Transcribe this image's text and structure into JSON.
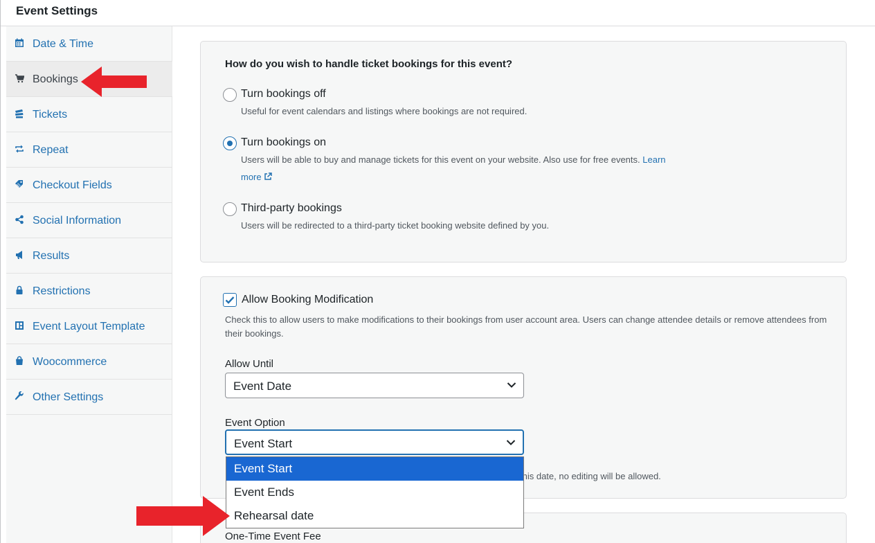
{
  "header": {
    "title": "Event Settings"
  },
  "sidebar": {
    "items": [
      {
        "label": "Date & Time",
        "icon": "calendar-icon"
      },
      {
        "label": "Bookings",
        "icon": "cart-icon"
      },
      {
        "label": "Tickets",
        "icon": "tickets-icon"
      },
      {
        "label": "Repeat",
        "icon": "repeat-icon"
      },
      {
        "label": "Checkout Fields",
        "icon": "tag-icon"
      },
      {
        "label": "Social Information",
        "icon": "share-icon"
      },
      {
        "label": "Results",
        "icon": "megaphone-icon"
      },
      {
        "label": "Restrictions",
        "icon": "lock-icon"
      },
      {
        "label": "Event Layout Template",
        "icon": "layout-icon"
      },
      {
        "label": "Woocommerce",
        "icon": "bag-icon"
      },
      {
        "label": "Other Settings",
        "icon": "wrench-icon"
      }
    ],
    "active_index": 1
  },
  "bookings": {
    "question": "How do you wish to handle ticket bookings for this event?",
    "options": [
      {
        "label": "Turn bookings off",
        "description": "Useful for event calendars and listings where bookings are not required."
      },
      {
        "label": "Turn bookings on",
        "description": "Users will be able to buy and manage tickets for this event on your website. Also use for free events.",
        "link_text_1": "Learn",
        "link_text_2": "more"
      },
      {
        "label": "Third-party bookings",
        "description": "Users will be redirected to a third-party ticket booking website defined by you."
      }
    ],
    "selected": "Turn bookings on"
  },
  "modification": {
    "checkbox_label": "Allow Booking Modification",
    "checked": true,
    "description": "Check this to allow users to make modifications to their bookings from user account area. Users can change attendee details or remove attendees from their bookings.",
    "allow_until_label": "Allow Until",
    "allow_until_value": "Event Date",
    "event_option_label": "Event Option",
    "event_option_value": "Event Start",
    "hint_visible_fragment": "this date, no editing will be allowed.",
    "dropdown_options": [
      "Event Start",
      "Event Ends",
      "Rehearsal date"
    ],
    "dropdown_highlighted": "Event Start"
  },
  "fee": {
    "label": "One-Time Event Fee"
  },
  "colors": {
    "link": "#2271b1",
    "annotation_arrow": "#e8232b",
    "dropdown_highlight": "#1967d2"
  }
}
